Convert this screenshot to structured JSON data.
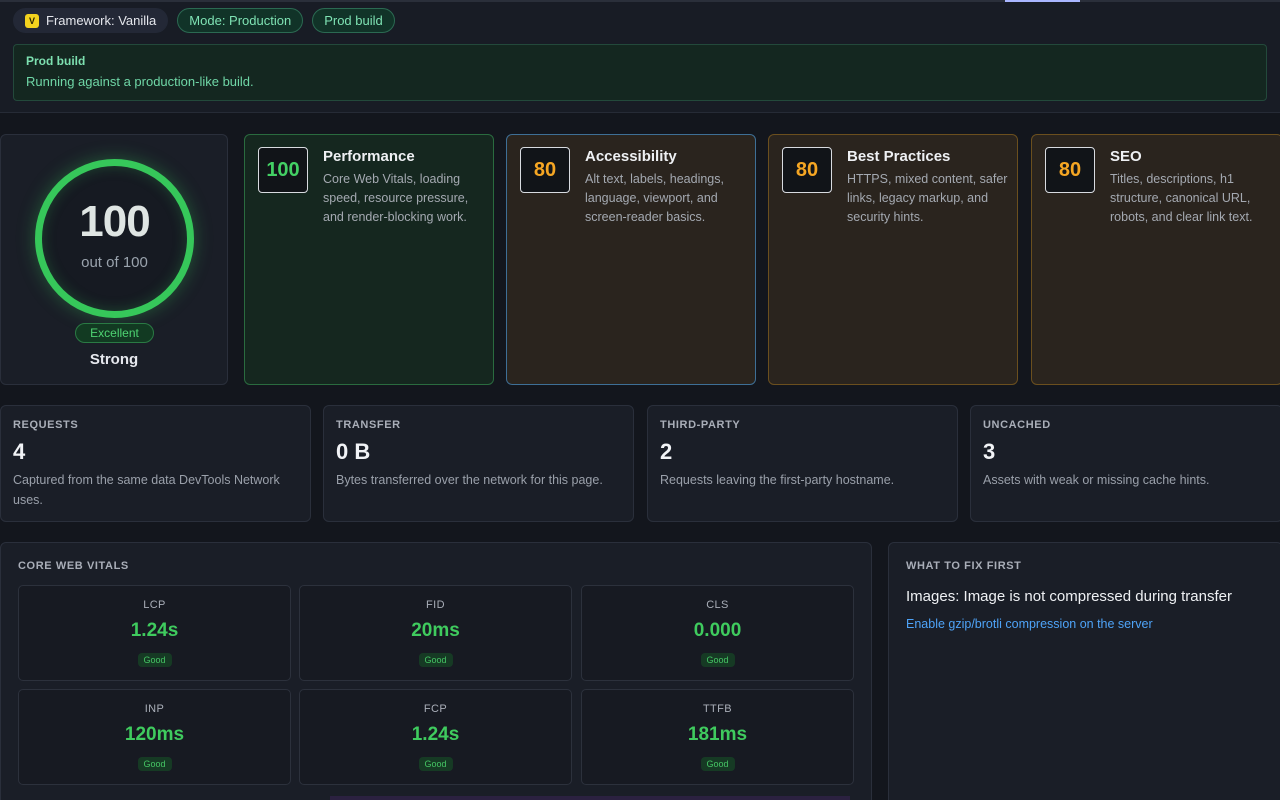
{
  "chips": {
    "framework_badge": "V",
    "framework": "Framework: Vanilla",
    "mode": "Mode: Production",
    "build": "Prod build"
  },
  "banner": {
    "title": "Prod build",
    "text": "Running against a production-like build."
  },
  "overall": {
    "score": "100",
    "out_of": "out of 100",
    "badge": "Excellent",
    "verdict": "Strong",
    "color": "#36c75a"
  },
  "categories": [
    {
      "score": "100",
      "title": "Performance",
      "desc": "Core Web Vitals, loading speed, resource pressure, and render-blocking work.",
      "status": "good"
    },
    {
      "score": "80",
      "title": "Accessibility",
      "desc": "Alt text, labels, headings, language, viewport, and screen-reader basics.",
      "status": "warn"
    },
    {
      "score": "80",
      "title": "Best Practices",
      "desc": "HTTPS, mixed content, safer links, legacy markup, and security hints.",
      "status": "warn"
    },
    {
      "score": "80",
      "title": "SEO",
      "desc": "Titles, descriptions, h1 structure, canonical URL, robots, and clear link text.",
      "status": "warn"
    }
  ],
  "stats": [
    {
      "label": "REQUESTS",
      "value": "4",
      "desc": "Captured from the same data DevTools Network uses."
    },
    {
      "label": "TRANSFER",
      "value": "0 B",
      "desc": "Bytes transferred over the network for this page."
    },
    {
      "label": "THIRD-PARTY",
      "value": "2",
      "desc": "Requests leaving the first-party hostname."
    },
    {
      "label": "UNCACHED",
      "value": "3",
      "desc": "Assets with weak or missing cache hints."
    }
  ],
  "vitals": {
    "title": "CORE WEB VITALS",
    "items": [
      {
        "label": "LCP",
        "value": "1.24s",
        "badge": "Good"
      },
      {
        "label": "FID",
        "value": "20ms",
        "badge": "Good"
      },
      {
        "label": "CLS",
        "value": "0.000",
        "badge": "Good"
      },
      {
        "label": "INP",
        "value": "120ms",
        "badge": "Good"
      },
      {
        "label": "FCP",
        "value": "1.24s",
        "badge": "Good"
      },
      {
        "label": "TTFB",
        "value": "181ms",
        "badge": "Good"
      }
    ]
  },
  "fix_first": {
    "title": "WHAT TO FIX FIRST",
    "issue": "Images: Image is not compressed during transfer",
    "action": "Enable gzip/brotli compression on the server"
  },
  "colors": {
    "good": "#43d064",
    "warn": "#f5a623",
    "link": "#4ea3f7"
  }
}
